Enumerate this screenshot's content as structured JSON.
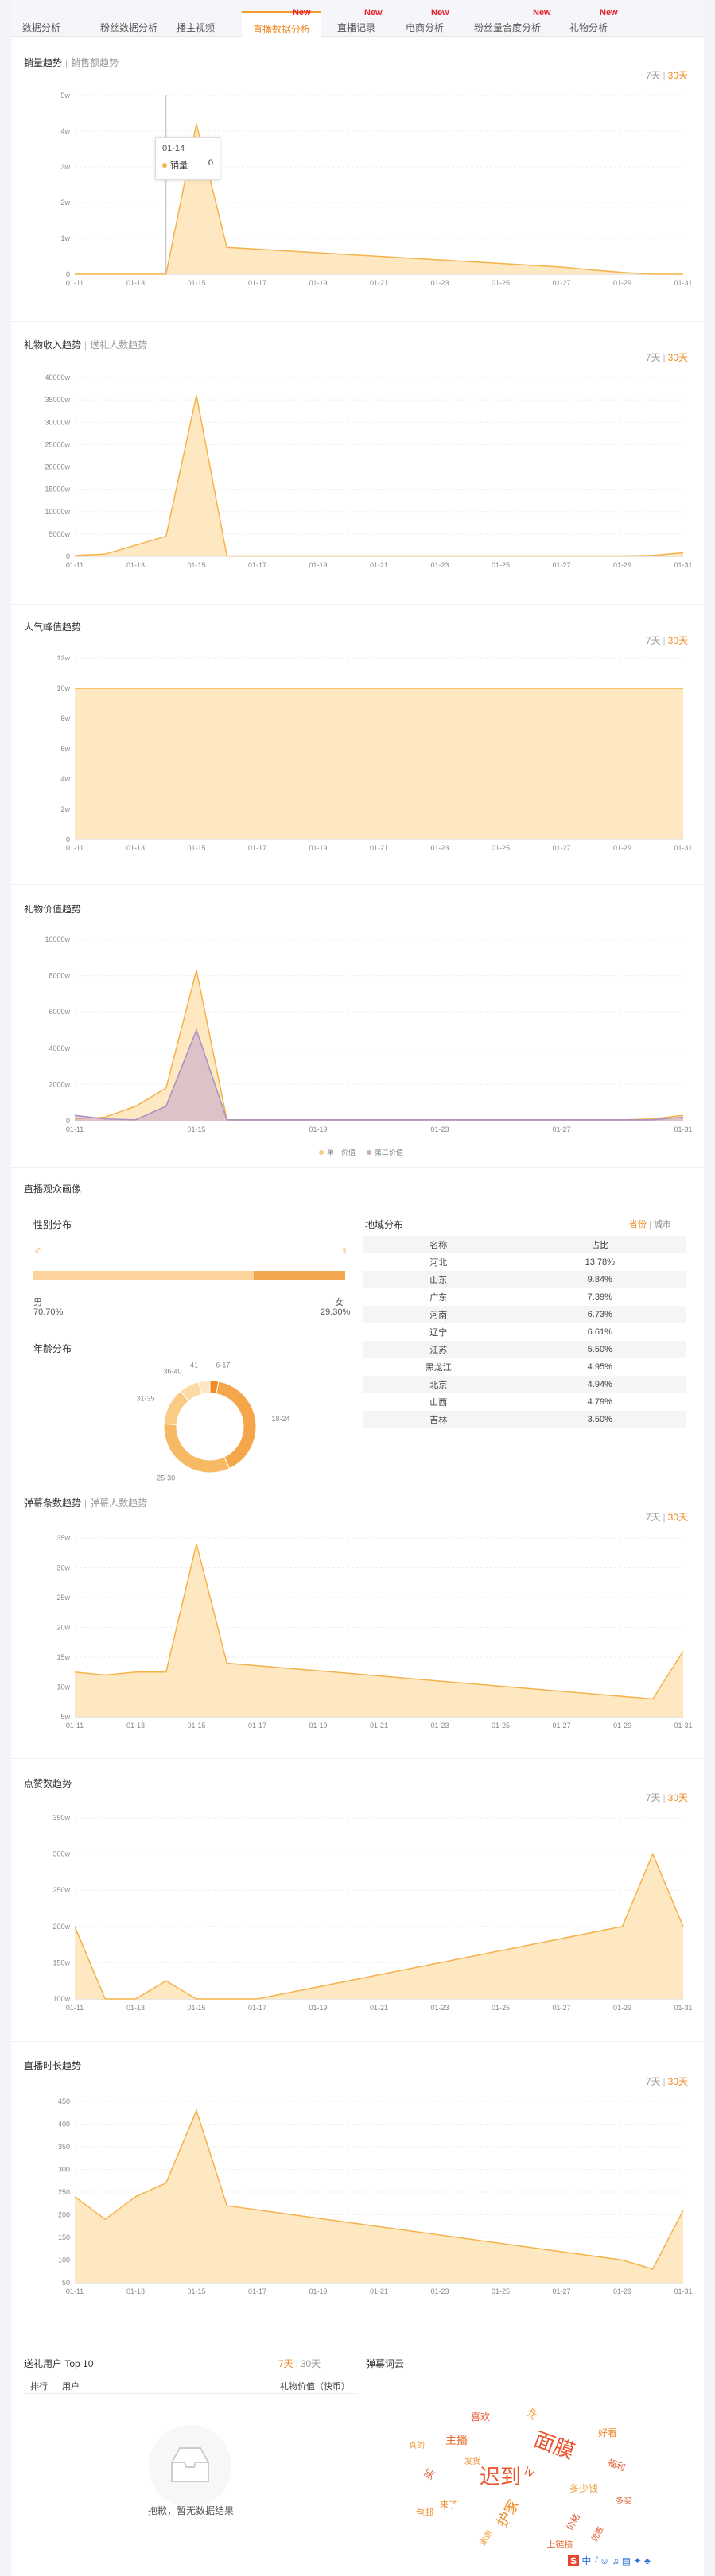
{
  "tabs": [
    {
      "label": "数据分析",
      "new": false
    },
    {
      "label": "粉丝数据分析",
      "new": false
    },
    {
      "label": "播主视频",
      "new": false
    },
    {
      "label": "直播数据分析",
      "new": true,
      "active": true
    },
    {
      "label": "直播记录",
      "new": true
    },
    {
      "label": "电商分析",
      "new": true
    },
    {
      "label": "粉丝量合度分析",
      "new": true
    },
    {
      "label": "礼物分析",
      "new": true
    }
  ],
  "new_label": "New",
  "range": {
    "d7": "7天",
    "d30": "30天",
    "sep": "|"
  },
  "dates": [
    "01-11",
    "01-13",
    "01-15",
    "01-17",
    "01-19",
    "01-21",
    "01-23",
    "01-25",
    "01-27",
    "01-29",
    "01-31"
  ],
  "sales": {
    "title": "销量趋势",
    "sub": "销售额趋势",
    "tooltip_date": "01-14",
    "tooltip_label": "销量",
    "tooltip_value": "0",
    "y_ticks": [
      "5w",
      "4w",
      "3w",
      "2w",
      "1w",
      "0"
    ]
  },
  "gift_income": {
    "title": "礼物收入趋势",
    "sub": "送礼人数趋势",
    "y_ticks": [
      "40000w",
      "35000w",
      "30000w",
      "25000w",
      "20000w",
      "15000w",
      "10000w",
      "5000w",
      "0"
    ]
  },
  "popularity": {
    "title": "人气峰值趋势",
    "y_ticks": [
      "12w",
      "10w",
      "8w",
      "6w",
      "4w",
      "2w",
      "0"
    ]
  },
  "gift_value": {
    "title": "礼物价值趋势",
    "y_ticks": [
      "10000w",
      "8000w",
      "6000w",
      "4000w",
      "2000w",
      "0"
    ],
    "x_ticks": [
      "01-11",
      "01-15",
      "01-19",
      "01-23",
      "01-27",
      "01-31"
    ],
    "legend": [
      "单一价值",
      "第二价值"
    ]
  },
  "audience": {
    "title": "直播观众画像",
    "gender_title": "性别分布",
    "male": "男",
    "female": "女",
    "male_pct": "70.70%",
    "female_pct": "29.30%",
    "male_value": 0.707,
    "age_title": "年龄分布",
    "age_groups": [
      {
        "label": "6-17",
        "value": 3
      },
      {
        "label": "18-24",
        "value": 40
      },
      {
        "label": "25-30",
        "value": 33
      },
      {
        "label": "31-35",
        "value": 13
      },
      {
        "label": "36-40",
        "value": 7
      },
      {
        "label": "41+",
        "value": 4
      }
    ],
    "region_title": "地域分布",
    "region_tab_province": "省份",
    "region_tab_city": "城市",
    "region_col_name": "名称",
    "region_col_ratio": "占比",
    "regions": [
      {
        "name": "河北",
        "pct": "13.78%"
      },
      {
        "name": "山东",
        "pct": "9.84%"
      },
      {
        "name": "广东",
        "pct": "7.39%"
      },
      {
        "name": "河南",
        "pct": "6.73%"
      },
      {
        "name": "辽宁",
        "pct": "6.61%"
      },
      {
        "name": "江苏",
        "pct": "5.50%"
      },
      {
        "name": "黑龙江",
        "pct": "4.95%"
      },
      {
        "name": "北京",
        "pct": "4.94%"
      },
      {
        "name": "山西",
        "pct": "4.79%"
      },
      {
        "name": "吉林",
        "pct": "3.50%"
      }
    ]
  },
  "danmu": {
    "title": "弹幕条数趋势",
    "sub": "弹幕人数趋势",
    "y_ticks": [
      "35w",
      "30w",
      "25w",
      "20w",
      "15w",
      "10w",
      "5w"
    ]
  },
  "likes": {
    "title": "点赞数趋势",
    "y_ticks": [
      "350w",
      "300w",
      "250w",
      "200w",
      "150w",
      "100w"
    ]
  },
  "duration": {
    "title": "直播时长趋势",
    "y_ticks": [
      "450",
      "400",
      "350",
      "300",
      "250",
      "200",
      "150",
      "100",
      "50"
    ]
  },
  "top10": {
    "title": "送礼用户 Top 10",
    "col_rank": "排行",
    "col_user": "用户",
    "col_value": "礼物价值（快币）",
    "empty": "抱歉，暂无数据结果"
  },
  "wordcloud": {
    "title": "弹幕词云",
    "words": [
      "迟到",
      "面膜",
      "护家",
      "主播",
      "多少钱",
      "买",
      "好看",
      "喜欢",
      "冲",
      "lv",
      "来了",
      "价格",
      "包邮",
      "福利",
      "谢谢",
      "上链接",
      "发货",
      "优惠",
      "真的",
      "多买"
    ]
  },
  "colors": {
    "accent": "#f08a24",
    "area_fill": "#fde8c2",
    "area_line": "#f5b24a",
    "series2": "#c8a9c9"
  },
  "chart_data": [
    {
      "type": "area",
      "title": "销量趋势",
      "x": [
        "01-11",
        "01-12",
        "01-13",
        "01-14",
        "01-15",
        "01-16",
        "01-17",
        "01-18",
        "01-19",
        "01-20",
        "01-21",
        "01-22",
        "01-23",
        "01-24",
        "01-25",
        "01-26",
        "01-27",
        "01-28",
        "01-29",
        "01-30",
        "01-31"
      ],
      "values": [
        0,
        0,
        0,
        0,
        42000,
        7500,
        7000,
        6500,
        6000,
        5500,
        5000,
        4500,
        4000,
        3500,
        3000,
        2500,
        2000,
        1200,
        500,
        0,
        0
      ],
      "ylim": [
        0,
        50000
      ]
    },
    {
      "type": "area",
      "title": "礼物收入趋势",
      "x": [
        "01-11",
        "01-12",
        "01-13",
        "01-14",
        "01-15",
        "01-16",
        "01-17",
        "01-18",
        "01-19",
        "01-20",
        "01-21",
        "01-22",
        "01-23",
        "01-24",
        "01-25",
        "01-26",
        "01-27",
        "01-28",
        "01-29",
        "01-30",
        "01-31"
      ],
      "values": [
        200,
        500,
        2500,
        4500,
        36000,
        100,
        100,
        100,
        100,
        100,
        100,
        100,
        100,
        100,
        100,
        100,
        100,
        100,
        100,
        200,
        800
      ],
      "ylim": [
        0,
        40000
      ]
    },
    {
      "type": "area",
      "title": "人气峰值趋势",
      "x": [
        "01-11",
        "01-31"
      ],
      "values": [
        10,
        10
      ],
      "ylim": [
        0,
        12
      ]
    },
    {
      "type": "area",
      "title": "礼物价值趋势",
      "x": [
        "01-11",
        "01-12",
        "01-13",
        "01-14",
        "01-15",
        "01-16",
        "01-17",
        "01-18",
        "01-19",
        "01-20",
        "01-21",
        "01-22",
        "01-23",
        "01-24",
        "01-25",
        "01-26",
        "01-27",
        "01-28",
        "01-29",
        "01-30",
        "01-31"
      ],
      "series": [
        {
          "name": "单一价值",
          "values": [
            100,
            200,
            800,
            1800,
            8300,
            50,
            50,
            50,
            50,
            50,
            50,
            50,
            50,
            50,
            50,
            50,
            50,
            50,
            50,
            100,
            300
          ]
        },
        {
          "name": "第二价值",
          "values": [
            300,
            100,
            50,
            800,
            5000,
            50,
            50,
            50,
            50,
            50,
            50,
            50,
            50,
            50,
            50,
            50,
            50,
            50,
            50,
            50,
            200
          ]
        }
      ],
      "ylim": [
        0,
        10000
      ]
    },
    {
      "type": "area",
      "title": "弹幕条数趋势",
      "x": [
        "01-11",
        "01-12",
        "01-13",
        "01-14",
        "01-15",
        "01-16",
        "01-30",
        "01-31"
      ],
      "values": [
        12.5,
        12,
        12.5,
        12.5,
        34,
        14,
        8,
        16
      ],
      "ylim": [
        5,
        35
      ]
    },
    {
      "type": "area",
      "title": "点赞数趋势",
      "x": [
        "01-11",
        "01-12",
        "01-13",
        "01-14",
        "01-15",
        "01-16",
        "01-17",
        "01-29",
        "01-30",
        "01-31"
      ],
      "values": [
        200,
        100,
        100,
        125,
        100,
        100,
        100,
        200,
        300,
        200
      ],
      "ylim": [
        100,
        350
      ]
    },
    {
      "type": "area",
      "title": "直播时长趋势",
      "x": [
        "01-11",
        "01-12",
        "01-13",
        "01-14",
        "01-15",
        "01-16",
        "01-29",
        "01-30",
        "01-31"
      ],
      "values": [
        240,
        190,
        240,
        270,
        430,
        220,
        100,
        80,
        210
      ],
      "ylim": [
        50,
        450
      ]
    }
  ]
}
